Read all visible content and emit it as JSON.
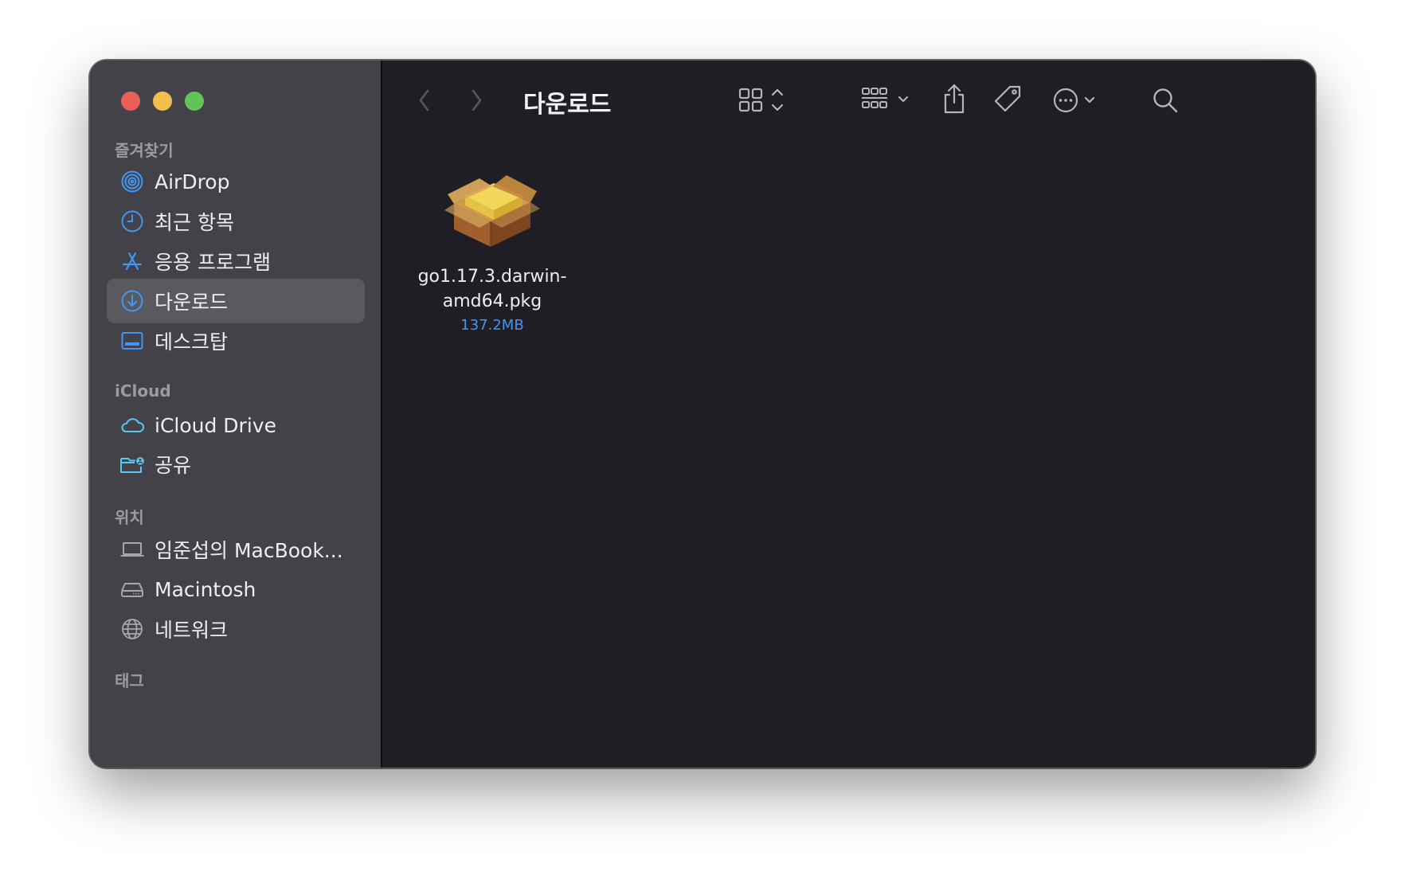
{
  "window": {
    "title": "다운로드"
  },
  "sidebar": {
    "sections": [
      {
        "title": "즐겨찾기",
        "items": [
          {
            "label": "AirDrop",
            "icon": "airdrop-icon"
          },
          {
            "label": "최근 항목",
            "icon": "clock-icon"
          },
          {
            "label": "응용 프로그램",
            "icon": "applications-icon"
          },
          {
            "label": "다운로드",
            "icon": "download-icon",
            "selected": true
          },
          {
            "label": "데스크탑",
            "icon": "desktop-icon"
          }
        ]
      },
      {
        "title": "iCloud",
        "items": [
          {
            "label": "iCloud Drive",
            "icon": "cloud-icon"
          },
          {
            "label": "공유",
            "icon": "shared-folder-icon"
          }
        ]
      },
      {
        "title": "위치",
        "items": [
          {
            "label": "임준섭의 MacBook...",
            "icon": "laptop-icon"
          },
          {
            "label": "Macintosh",
            "icon": "hard-drive-icon"
          },
          {
            "label": "네트워크",
            "icon": "globe-icon"
          }
        ]
      },
      {
        "title": "태그",
        "items": []
      }
    ]
  },
  "files": [
    {
      "name": "go1.17.3.darwin-amd64.pkg",
      "name_line1": "go1.17.3.darwin-",
      "name_line2": "amd64.pkg",
      "size": "137.2MB",
      "icon": "package-icon"
    }
  ],
  "colors": {
    "accent": "#4b91f5",
    "sidebar_icon": "#3e97f7",
    "cloud_icon": "#5ac8f5",
    "close": "#ec5f57",
    "minimize": "#f4be4f",
    "maximize": "#61c454"
  }
}
